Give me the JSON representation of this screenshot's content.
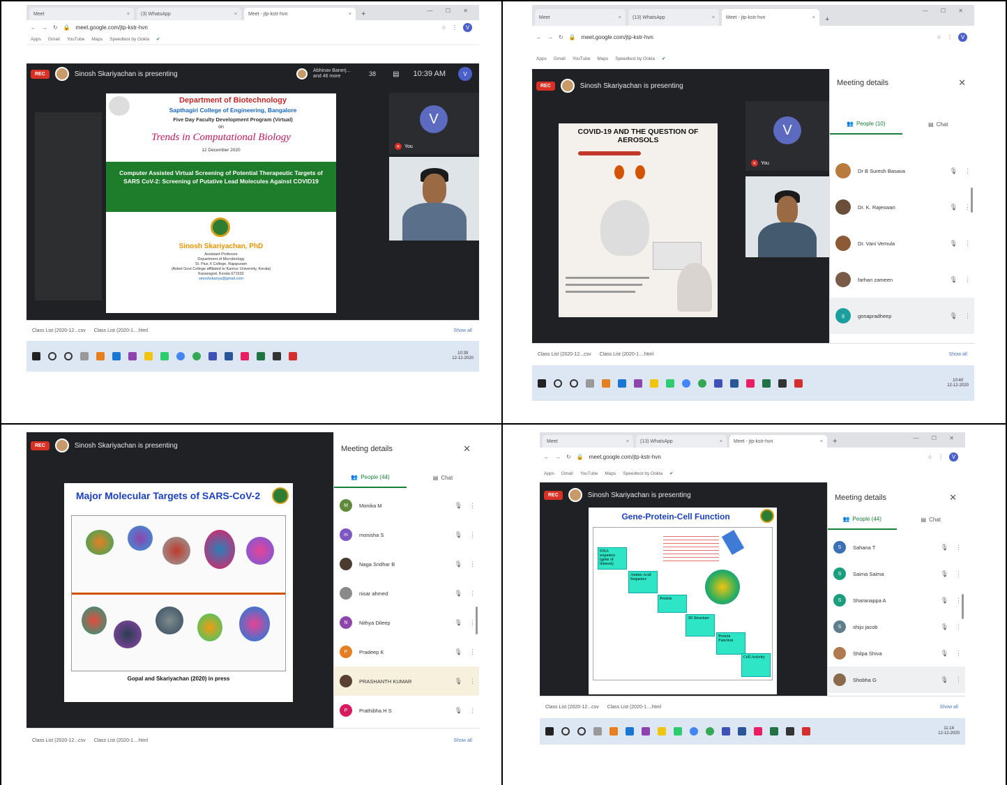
{
  "q1": {
    "tabs": [
      {
        "title": "Meet"
      },
      {
        "title": "(3) WhatsApp"
      },
      {
        "title": "Meet - jtp-kstr-hvn"
      }
    ],
    "url": "meet.google.com/jtp-kstr-hvn",
    "bookmarks": [
      "Apps",
      "Gmail",
      "YouTube",
      "Maps",
      "Speedtest by Ookla"
    ],
    "rec": "REC",
    "presenting": "Sinosh Skariyachan is presenting",
    "participants_label": "Abhinav Banerj...",
    "participants_more": "and 46 more",
    "count": "38",
    "time": "10:39 AM",
    "you": "You",
    "self_initial": "V",
    "slide": {
      "dept": "Department of Biotechnology",
      "college": "Sapthagiri College of Engineering, Bangalore",
      "program": "Five Day Faculty Development Program (Virtual)",
      "on": "on",
      "trends": "Trends in Computational Biology",
      "date": "12 December 2020",
      "talk": "Computer Assisted Virtual Screening of Potential Therapeutic Targets of SARS CoV-2: Screening of Putative Lead Molecules Against COVID19",
      "speaker": "Sinosh Skariyachan, PhD",
      "role": "Assistant Professor",
      "dept2": "Department of Microbiology",
      "inst": "St. Pius X College, Rajapuram",
      "affil": "(Aided Govt College affiliated to Kannur University, Kerala)",
      "place": "Kasaragod, Kerala 671532",
      "email": "sinoshskariya@gmail.com"
    },
    "downloads": [
      "Class List (2020-12...csv",
      "Class List (2020-1....html"
    ],
    "show_all": "Show all",
    "clock_time": "10:39",
    "clock_date": "12-12-2020"
  },
  "q2": {
    "tabs": [
      {
        "title": "Meet"
      },
      {
        "title": "(13) WhatsApp"
      },
      {
        "title": "Meet - jtp-kstr-hvn"
      }
    ],
    "url": "meet.google.com/jtp-kstr-hvn",
    "bookmarks": [
      "Apps",
      "Gmail",
      "YouTube",
      "Maps",
      "Speedtest by Ookla"
    ],
    "rec": "REC",
    "presenting": "Sinosh Skariyachan is presenting",
    "you": "You",
    "self_initial": "V",
    "slide": {
      "title": "COVID-19 AND THE QUESTION OF AEROSOLS"
    },
    "meeting_details": "Meeting details",
    "people_tab": "People (10)",
    "chat_tab": "Chat",
    "people": [
      {
        "name": "Dr B Suresh Basava",
        "color": "#b97a3d"
      },
      {
        "name": "Dr. K. Rajeswari",
        "color": "#6b4f3a"
      },
      {
        "name": "Dr. Vani Vemula",
        "color": "#8c5a35"
      },
      {
        "name": "farhan zameen",
        "color": "#7a5a48"
      },
      {
        "name": "gonapradheep",
        "color": "#1a9e9e"
      }
    ],
    "downloads": [
      "Class List (2020-12...csv",
      "Class List (2020-1....html"
    ],
    "show_all": "Show all",
    "clock_time": "10:40",
    "clock_date": "12-12-2020"
  },
  "q3": {
    "rec": "REC",
    "presenting": "Sinosh Skariyachan is presenting",
    "slide": {
      "title": "Major Molecular Targets of SARS-CoV-2",
      "caption": "Gopal and Skariyachan (2020) in press"
    },
    "meeting_details": "Meeting details",
    "people_tab": "People (44)",
    "chat_tab": "Chat",
    "people": [
      {
        "name": "Monika M",
        "initial": "M",
        "color": "#5f8a3a"
      },
      {
        "name": "monisha S",
        "initial": "m",
        "color": "#7e57c2"
      },
      {
        "name": "Naga Sridhar B",
        "initial": "",
        "color": "#4a3b2e"
      },
      {
        "name": "nisar ahmed",
        "initial": "",
        "color": "#8a8a8a"
      },
      {
        "name": "Nithya Dileep",
        "initial": "N",
        "color": "#8e44ad"
      },
      {
        "name": "Pradeep K",
        "initial": "P",
        "color": "#e67e22"
      },
      {
        "name": "PRASHANTH KUMAR",
        "initial": "",
        "color": "#5a4030"
      },
      {
        "name": "Prathibha H S",
        "initial": "P",
        "color": "#d81b60"
      }
    ],
    "downloads": [
      "Class List (2020-12...csv",
      "Class List (2020-1....html"
    ],
    "show_all": "Show all"
  },
  "q4": {
    "tabs": [
      {
        "title": "Meet"
      },
      {
        "title": "(13) WhatsApp"
      },
      {
        "title": "Meet - jtp-kstr-hvn"
      }
    ],
    "url": "meet.google.com/jtp-kstr-hvn",
    "bookmarks": [
      "Apps",
      "Gmail",
      "YouTube",
      "Maps",
      "Speedtest by Ookla"
    ],
    "rec": "REC",
    "presenting": "Sinosh Skariyachan is presenting",
    "slide": {
      "title": "Gene-Protein-Cell Function",
      "steps": [
        "DNA sequence (gene of interest)",
        "Amino Acid Sequence",
        "Protein",
        "3D Structure",
        "Protein Function",
        "Cell Activity"
      ]
    },
    "meeting_details": "Meeting details",
    "people_tab": "People (44)",
    "chat_tab": "Chat",
    "people": [
      {
        "name": "Sahana T",
        "initial": "S",
        "color": "#3b6fb6"
      },
      {
        "name": "Saima Saima",
        "initial": "S",
        "color": "#1a9e7e"
      },
      {
        "name": "Sharanappa A",
        "initial": "S",
        "color": "#1a9e7e"
      },
      {
        "name": "shiju jacob",
        "initial": "S",
        "color": "#607d8b"
      },
      {
        "name": "Shilpa Shiva",
        "initial": "",
        "color": "#b07a50"
      },
      {
        "name": "Shobha G",
        "initial": "",
        "color": "#8a6a4a"
      }
    ],
    "downloads": [
      "Class List (2020-12...csv",
      "Class List (2020-1....html"
    ],
    "show_all": "Show all",
    "clock_time": "11:14",
    "clock_date": "12-12-2020"
  }
}
